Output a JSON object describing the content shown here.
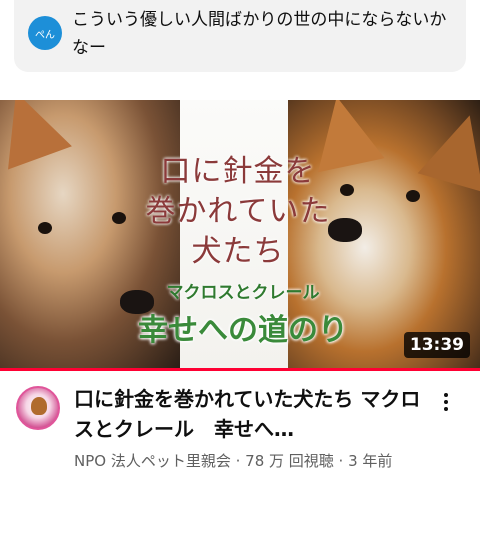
{
  "comment": {
    "avatar_text": "ぺん",
    "text": "こういう優しい人間ばかりの世の中にならないかなー"
  },
  "thumbnail": {
    "title_line1": "口に針金を",
    "title_line2": "巻かれていた",
    "title_line3": "犬たち",
    "names": "マクロスとクレール",
    "subtitle": "幸せへの道のり",
    "duration": "13:39"
  },
  "video": {
    "title": "口に針金を巻かれていた犬たち マクロスとクレール　幸せへ…",
    "meta": "NPO 法人ペット里親会 · 78 万 回視聴 · 3 年前"
  },
  "colors": {
    "title_red": "#8b3a3a",
    "subtitle_green": "#3a8a3a",
    "progress": "#ff0033"
  }
}
